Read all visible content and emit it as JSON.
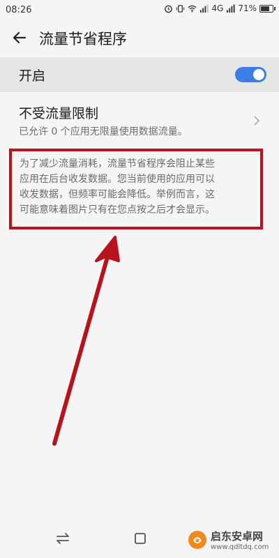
{
  "status_bar": {
    "time": "08:26",
    "network": "4G",
    "battery": "71%",
    "icons": [
      "alarm-icon",
      "vibrate-icon",
      "wifi-icon",
      "signal-icon",
      "signal-icon",
      "battery-icon"
    ]
  },
  "app_bar": {
    "title": "流量节省程序",
    "back_icon": "arrow-left-icon"
  },
  "toggle": {
    "label": "开启",
    "state": "on",
    "accent_color": "#3d7de6"
  },
  "unrestricted": {
    "title": "不受流量限制",
    "subtitle": "已允许 0 个应用无限量使用数据流量。"
  },
  "description": {
    "lines": [
      "为了减少流量消耗，流量节省程序会阻止某些",
      "应用在后台收发数据。您当前使用的应用可以",
      "收发数据，但频率可能会降低。举例而言，这",
      "可能意味着图片只有在您点按之后才会显示。"
    ],
    "highlight_color": "#b8131d"
  },
  "nav_bar": {
    "buttons": [
      "switch-apps-icon",
      "home-icon",
      "back-icon"
    ]
  },
  "watermark": {
    "title": "启东安卓网",
    "url": "www.qdltdq.com"
  }
}
